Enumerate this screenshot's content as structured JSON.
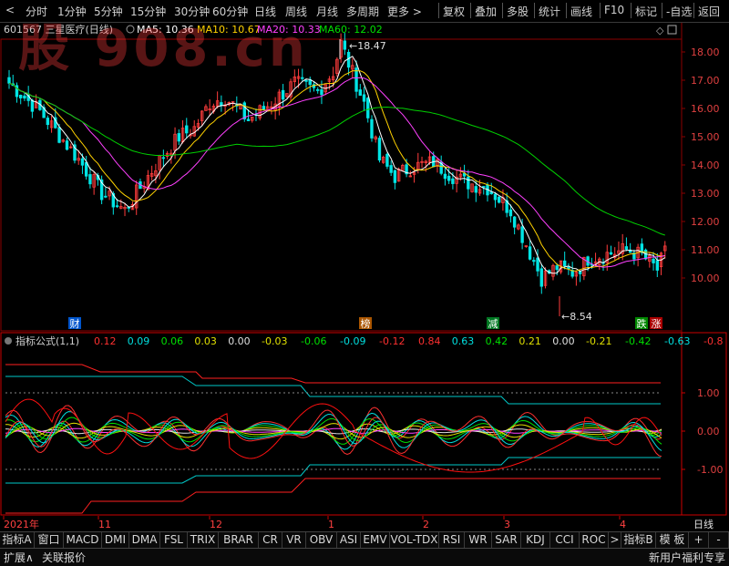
{
  "toolbar": {
    "left": [
      "分时",
      "1分钟",
      "5分钟",
      "15分钟",
      "30分钟",
      "60分钟",
      "日线",
      "周线",
      "月线",
      "多周期",
      "更多"
    ],
    "right": [
      "复权",
      "叠加",
      "多股",
      "统计",
      "画线",
      "F10",
      "标记",
      "-自选",
      "返回"
    ]
  },
  "stock": {
    "code": "601567",
    "name": "三星医疗",
    "period": "(日线)"
  },
  "ma_legend": [
    {
      "label": "MA5: 10.36",
      "color": "#ffffff"
    },
    {
      "label": "MA10: 10.67",
      "color": "#ffd200"
    },
    {
      "label": "MA20: 10.33",
      "color": "#ff40ff"
    },
    {
      "label": "MA60: 12.02",
      "color": "#00e000"
    }
  ],
  "price_axis": [
    "18.00",
    "17.00",
    "16.00",
    "15.00",
    "14.00",
    "13.00",
    "12.00",
    "11.00",
    "10.00"
  ],
  "annotations": {
    "high": "18.47",
    "low": "8.54"
  },
  "event_tags": [
    {
      "label": "财",
      "bg": "#0055cc"
    },
    {
      "label": "榜",
      "bg": "#aa5500"
    },
    {
      "label": "减",
      "bg": "#007722"
    },
    {
      "label": "跌",
      "bg": "#008800"
    },
    {
      "label": "涨",
      "bg": "#aa0000"
    }
  ],
  "indicator": {
    "title": "指标公式(1,1)",
    "values": [
      {
        "v": "0.12",
        "c": "#ff3030"
      },
      {
        "v": "0.09",
        "c": "#00e0e0"
      },
      {
        "v": "0.06",
        "c": "#00e000"
      },
      {
        "v": "0.03",
        "c": "#e0e000"
      },
      {
        "v": "0.00",
        "c": "#e0e0e0"
      },
      {
        "v": "-0.03",
        "c": "#e0e000"
      },
      {
        "v": "-0.06",
        "c": "#00e000"
      },
      {
        "v": "-0.09",
        "c": "#00e0e0"
      },
      {
        "v": "-0.12",
        "c": "#ff3030"
      },
      {
        "v": "0.84",
        "c": "#ff3030"
      },
      {
        "v": "0.63",
        "c": "#00e0e0"
      },
      {
        "v": "0.42",
        "c": "#00e000"
      },
      {
        "v": "0.21",
        "c": "#e0e000"
      },
      {
        "v": "0.00",
        "c": "#e0e0e0"
      },
      {
        "v": "-0.21",
        "c": "#e0e000"
      },
      {
        "v": "-0.42",
        "c": "#00e000"
      },
      {
        "v": "-0.63",
        "c": "#00e0e0"
      },
      {
        "v": "-0.8",
        "c": "#ff3030"
      }
    ],
    "axis": [
      "1.00",
      "0.00",
      "-1.00"
    ]
  },
  "date_axis": [
    "2021年",
    "11",
    "12",
    "1",
    "2",
    "3",
    "4"
  ],
  "period_label": "日线",
  "tabs": [
    "指标A",
    "窗口",
    "MACD",
    "DMI",
    "DMA",
    "FSL",
    "TRIX",
    "BRAR",
    "CR",
    "VR",
    "OBV",
    "ASI",
    "EMV",
    "VOL-TDX",
    "RSI",
    "WR",
    "SAR",
    "KDJ",
    "CCI",
    "ROC",
    ">",
    "指标B",
    "模 板",
    "+",
    "-"
  ],
  "status": {
    "left": [
      "扩展∧",
      "关联报价"
    ],
    "right": "新用户福利专享"
  },
  "watermark": "股 908.cn",
  "colors": {
    "up": "#ff3c3c",
    "down": "#00e5e5",
    "ma5": "#ffffff",
    "ma10": "#ffd200",
    "ma20": "#ff40ff",
    "ma60": "#00d000",
    "grid": "#8b0000"
  }
}
